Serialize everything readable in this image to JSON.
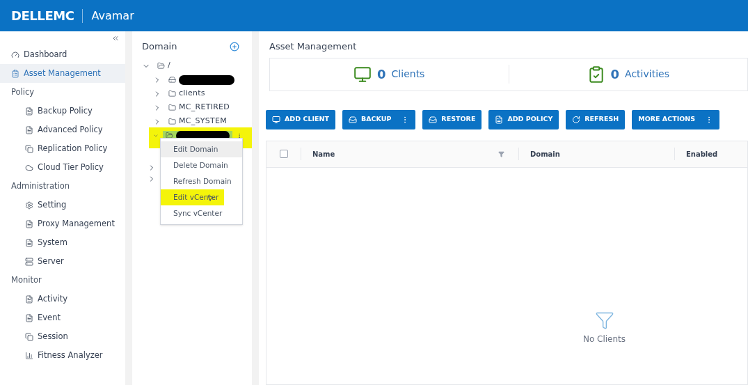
{
  "header": {
    "brand": "DELLEMC",
    "product": "Avamar"
  },
  "sidebar": {
    "items": [
      {
        "kind": "item",
        "label": "Dashboard",
        "selected": false
      },
      {
        "kind": "item",
        "label": "Asset Management",
        "selected": true
      },
      {
        "kind": "section",
        "label": "Policy"
      },
      {
        "kind": "subitem",
        "label": "Backup Policy",
        "selected": false
      },
      {
        "kind": "subitem",
        "label": "Advanced Policy",
        "selected": false
      },
      {
        "kind": "subitem",
        "label": "Replication Policy",
        "selected": false
      },
      {
        "kind": "subitem",
        "label": "Cloud Tier Policy",
        "selected": false
      },
      {
        "kind": "section",
        "label": "Administration"
      },
      {
        "kind": "subitem",
        "label": "Setting",
        "selected": false
      },
      {
        "kind": "subitem",
        "label": "Proxy Management",
        "selected": false
      },
      {
        "kind": "subitem",
        "label": "System",
        "selected": false
      },
      {
        "kind": "subitem",
        "label": "Server",
        "selected": false
      },
      {
        "kind": "section",
        "label": "Monitor"
      },
      {
        "kind": "subitem",
        "label": "Activity",
        "selected": false
      },
      {
        "kind": "subitem",
        "label": "Event",
        "selected": false
      },
      {
        "kind": "subitem",
        "label": "Session",
        "selected": false
      },
      {
        "kind": "subitem",
        "label": "Fitness Analyzer",
        "selected": false
      }
    ]
  },
  "domain_panel": {
    "title": "Domain",
    "tree": [
      {
        "label": "/",
        "expanded": true,
        "children": [
          {
            "kind": "server",
            "redacted": true,
            "expanded": false,
            "selected": false
          },
          {
            "kind": "folder",
            "label": "clients",
            "expanded": false,
            "selected": false
          },
          {
            "kind": "folder",
            "label": "MC_RETIRED",
            "expanded": false,
            "selected": false
          },
          {
            "kind": "folder",
            "label": "MC_SYSTEM",
            "expanded": false,
            "selected": false
          },
          {
            "kind": "folder",
            "redacted": true,
            "expanded": true,
            "selected": true
          }
        ]
      }
    ],
    "context_menu": [
      {
        "label": "Edit Domain",
        "hovered": true,
        "highlighted": false
      },
      {
        "label": "Delete Domain",
        "hovered": false,
        "highlighted": false
      },
      {
        "label": "Refresh Domain",
        "hovered": false,
        "highlighted": false
      },
      {
        "label": "Edit vCenter",
        "hovered": false,
        "highlighted": true
      },
      {
        "label": "Sync vCenter",
        "hovered": false,
        "highlighted": false
      }
    ]
  },
  "main": {
    "title": "Asset Management",
    "summary": [
      {
        "count": "0",
        "label": "Clients"
      },
      {
        "count": "0",
        "label": "Activities"
      }
    ],
    "buttons": [
      {
        "label": "ADD CLIENT",
        "menu": false
      },
      {
        "label": "BACKUP",
        "menu": true
      },
      {
        "label": "RESTORE",
        "menu": false
      },
      {
        "label": "ADD POLICY",
        "menu": false
      },
      {
        "label": "REFRESH",
        "menu": false
      },
      {
        "label": "MORE ACTIONS",
        "menu": true
      }
    ],
    "table": {
      "columns": [
        {
          "label": "Name",
          "filter": true
        },
        {
          "label": "Domain",
          "filter": false
        },
        {
          "label": "Enabled",
          "filter": false
        }
      ],
      "select_all": false,
      "empty_text": "No Clients"
    }
  }
}
